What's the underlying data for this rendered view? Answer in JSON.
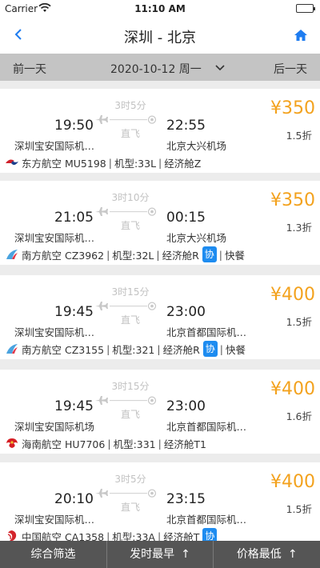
{
  "status_bar": {
    "carrier": "Carrier",
    "time": "11:10 AM"
  },
  "nav": {
    "title": "深圳 - 北京"
  },
  "date_bar": {
    "prev": "前一天",
    "current": "2020-10-12 周一",
    "next": "后一天"
  },
  "flights": [
    {
      "duration": "3时5分",
      "direct": "直飞",
      "dep_time": "19:50",
      "arr_time": "22:55",
      "dep_airport": "深圳宝安国际机…",
      "arr_airport": "北京大兴机场",
      "price": "¥350",
      "discount": "1.5折",
      "airline": "东方航空 MU5198",
      "aircraft": "机型:33L",
      "cabin": "经济舱Z",
      "logo": "china-eastern-logo",
      "xie": "",
      "meal": ""
    },
    {
      "duration": "3时10分",
      "direct": "直飞",
      "dep_time": "21:05",
      "arr_time": "00:15",
      "dep_airport": "深圳宝安国际机…",
      "arr_airport": "北京大兴机场",
      "price": "¥350",
      "discount": "1.3折",
      "airline": "南方航空 CZ3962",
      "aircraft": "机型:32L",
      "cabin": "经济舱R",
      "logo": "china-southern-logo",
      "xie": "协",
      "meal": "快餐"
    },
    {
      "duration": "3时15分",
      "direct": "直飞",
      "dep_time": "19:45",
      "arr_time": "23:00",
      "dep_airport": "深圳宝安国际机…",
      "arr_airport": "北京首都国际机…",
      "price": "¥400",
      "discount": "1.5折",
      "airline": "南方航空 CZ3155",
      "aircraft": "机型:321",
      "cabin": "经济舱R",
      "logo": "china-southern-logo",
      "xie": "协",
      "meal": "快餐"
    },
    {
      "duration": "3时15分",
      "direct": "直飞",
      "dep_time": "19:45",
      "arr_time": "23:00",
      "dep_airport": "深圳宝安国际机场",
      "arr_airport": "北京首都国际机…",
      "price": "¥400",
      "discount": "1.6折",
      "airline": "海南航空 HU7706",
      "aircraft": "机型:331",
      "cabin": "经济舱T1",
      "logo": "hainan-airlines-logo",
      "xie": "",
      "meal": ""
    },
    {
      "duration": "3时5分",
      "direct": "直飞",
      "dep_time": "20:10",
      "arr_time": "23:15",
      "dep_airport": "深圳宝安国际机…",
      "arr_airport": "北京首都国际机…",
      "price": "¥400",
      "discount": "1.5折",
      "airline": "中国航空 CA1358",
      "aircraft": "机型:33A",
      "cabin": "经济舱T",
      "logo": "air-china-logo",
      "xie": "协",
      "meal": ""
    }
  ],
  "bottom_bar": {
    "filter": "综合筛选",
    "earliest": "发时最早",
    "lowest_price": "价格最低",
    "arrow": "↑"
  },
  "colors": {
    "accent": "#1e7cf0",
    "price": "#f3a21e",
    "date_bar_bg": "#c4c4c4",
    "bottom_bar_bg": "#555555"
  }
}
